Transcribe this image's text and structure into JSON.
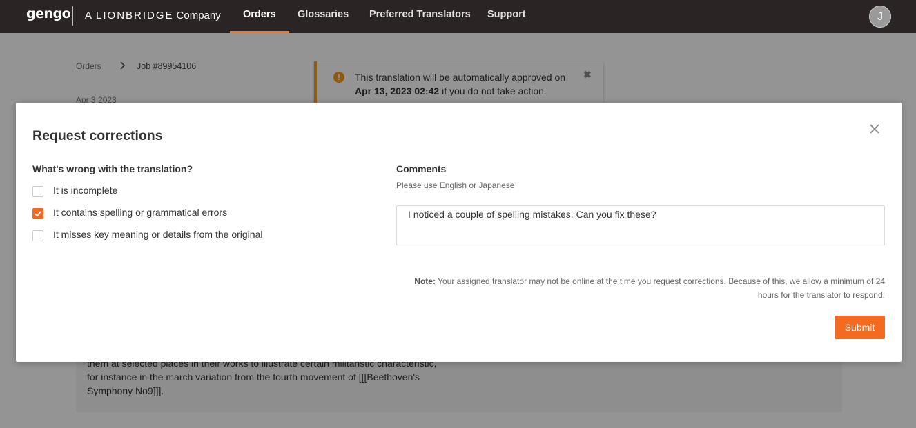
{
  "nav": {
    "logo": "gengo",
    "partner_prefix": "A",
    "partner_name": "LIONBRIDGE",
    "partner_suffix": "Company",
    "items": [
      {
        "label": "Orders",
        "active": true
      },
      {
        "label": "Glossaries",
        "active": false
      },
      {
        "label": "Preferred Translators",
        "active": false
      },
      {
        "label": "Support",
        "active": false
      }
    ],
    "avatar_initial": "J",
    "accent_color": "#f07a2c"
  },
  "background": {
    "breadcrumb": {
      "root": "Orders",
      "separator": ">",
      "current": "Job #89954106"
    },
    "date": "Apr 3 2023",
    "alert": {
      "text_before": "This translation will be automatically approved on",
      "date_bold": "Apr 13, 2023 02:42",
      "text_after": "if you do not take action.",
      "icon": "warning-icon",
      "close": "✖"
    },
    "paragraph": "them at selected places in their works to illustrate certain militaristic characteristic, for instance in the march variation from the fourth movement of [[[Beethoven's Symphony No9]]]."
  },
  "modal": {
    "title": "Request corrections",
    "question": "What's wrong with the translation?",
    "options": [
      {
        "label": "It is incomplete",
        "checked": false
      },
      {
        "label": "It contains spelling or grammatical errors",
        "checked": true
      },
      {
        "label": "It misses key meaning or details from the original",
        "checked": false
      }
    ],
    "comments_label": "Comments",
    "comments_hint": "Please use English or Japanese",
    "comments_value": "I noticed a couple of spelling mistakes. Can you fix these?",
    "note_label": "Note:",
    "note_text": "Your assigned translator may not be online at the time you request corrections. Because of this, we allow a minimum of 24 hours for the translator to respond.",
    "submit_label": "Submit",
    "submit_color": "#f26b21"
  }
}
